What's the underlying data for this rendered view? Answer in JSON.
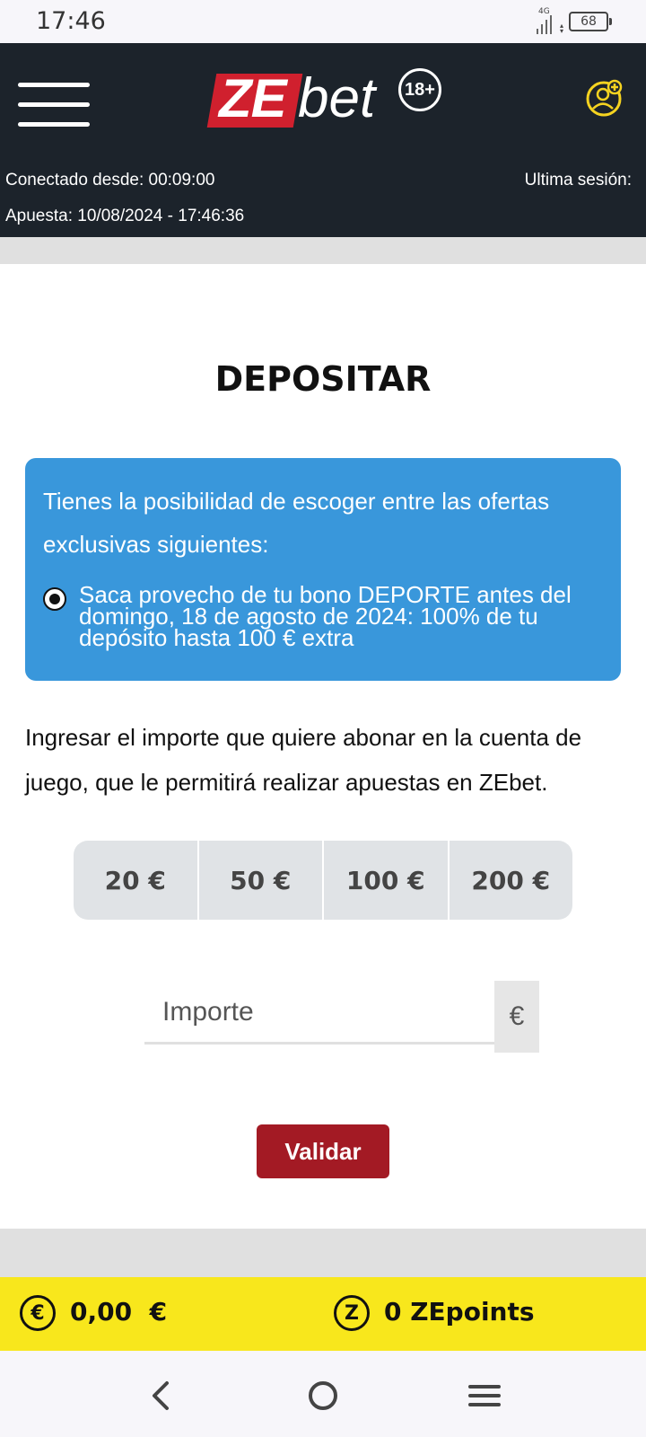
{
  "status_bar": {
    "time": "17:46",
    "network": "4G",
    "battery": "68",
    "icons": [
      "signal-icon",
      "battery-icon"
    ]
  },
  "header": {
    "logo_ze": "ZE",
    "logo_bet": "bet",
    "age_badge": "18+",
    "connected_label": "Conectado desde: 00:09:00",
    "last_session_label": "Ultima sesión:",
    "bet_label": "Apuesta: 10/08/2024 - 17:46:36",
    "icons": [
      "hamburger-menu-icon",
      "user-account-icon"
    ]
  },
  "main": {
    "title": "DEPOSITAR",
    "offer": {
      "intro": "Tienes la posibilidad de escoger entre las ofertas exclusivas siguientes:",
      "option": "Saca provecho de tu bono DEPORTE antes del domingo, 18 de agosto de 2024: 100% de tu depósito hasta 100 € extra",
      "selected": true
    },
    "description": "Ingresar el importe que quiere abonar en la cuenta de juego, que le permitirá realizar apuestas en ZEbet.",
    "amounts": [
      "20 €",
      "50 €",
      "100 €",
      "200 €"
    ],
    "amount_input": {
      "placeholder": "Importe",
      "value": "",
      "currency": "€"
    },
    "validate_label": "Validar"
  },
  "footer": {
    "balance_symbol": "€",
    "balance": "0,00  €",
    "points_symbol": "Z",
    "points": "0 ZEpoints"
  },
  "colors": {
    "header_bg": "#1c232b",
    "logo_red": "#d0202e",
    "offer_blue": "#3997db",
    "validate_red": "#a31a24",
    "footer_yellow": "#f8e71c",
    "user_icon_yellow": "#f5d320"
  },
  "nav": {
    "icons": [
      "back-icon",
      "home-icon",
      "recents-icon"
    ]
  }
}
